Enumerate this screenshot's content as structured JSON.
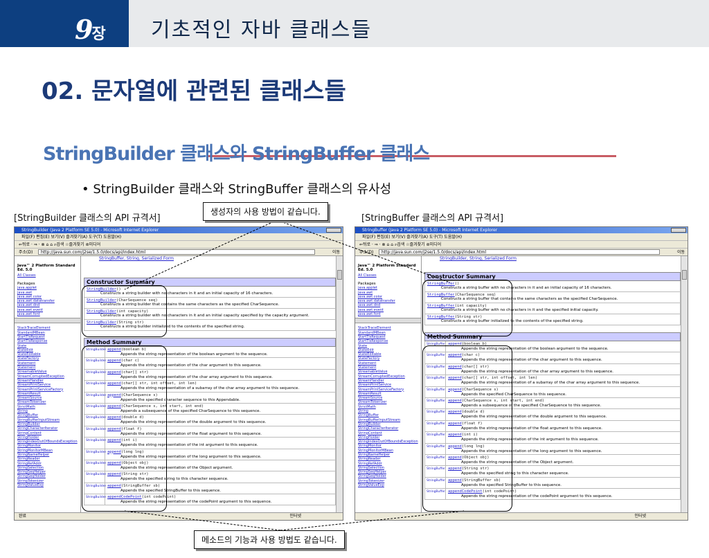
{
  "header": {
    "chapter_num": "9",
    "chapter_suffix": "장",
    "chapter_title": "기초적인 자바 클래스들"
  },
  "section": {
    "title": "02. 문자열에 관련된 클래스들",
    "subtitle": "StringBuilder 클래스와 StringBuffer 클래스",
    "bullet": "• StringBuilder 클래스와 StringBuffer 클래스의 유사성"
  },
  "captions": {
    "left": "[StringBuilder 클래스의 API 규격서]",
    "right": "[StringBuffer 클래스의 API 규격서]"
  },
  "callouts": {
    "top": "생성자의 사용 방법이 같습니다.",
    "bottom": "메소드의 기능과 사용 방법도 같습니다."
  },
  "browser_left": {
    "title": "StringBuilder (Java 2 Platform SE 5.0) - Microsoft Internet Explorer",
    "menu": "파일(F)  편집(E)  보기(V)  즐겨찾기(A)  도구(T)  도움말(H)",
    "toolbar": "⇐뒤로 · ⇒ · ⊗ ⌂ ⌂  ⌕검색  ☆즐겨찾기  ⊚미디어",
    "addr_label": "주소(D)",
    "url": "http://java.sun.com/j2se/1.5.0/docs/api/index.html",
    "go": "이동",
    "status": "완료",
    "zone": "인터넷",
    "top_link": "StringBuffer, String, Serialized Form"
  },
  "browser_right": {
    "title": "StringBuffer (Java 2 Platform SE 5.0) - Microsoft Internet Explorer",
    "menu": "파일(F)  편집(E)  보기(V)  즐겨찾기(A)  도구(T)  도움말(H)",
    "toolbar": "⇐뒤로 · ⇒ · ⊗ ⌂ ⌂  ⌕검색  ☆즐겨찾기  ⊚미디어",
    "addr_label": "주소(D)",
    "url": "http://java.sun.com/j2se/1.5.0/docs/api/index.html",
    "go": "이동",
    "status": "",
    "zone": "인터넷",
    "top_link": "StringBuilder, String, Serialized Form"
  },
  "nav": {
    "platform": "Java™ 2 Platform Standard Ed. 5.0",
    "all_classes": "All Classes",
    "packages_label": "Packages",
    "packages": [
      "java.applet",
      "java.awt",
      "java.awt.color",
      "java.awt.datatransfer",
      "java.awt.dnd",
      "java.awt.event",
      "java.awt.font"
    ],
    "classes": [
      "StackTraceElement",
      "StandardMBean",
      "StartTlsRequest",
      "StartTlsResponse",
      "State",
      "StateEdit",
      "StateEditable",
      "StateFactory",
      "Statement",
      "Statement",
      "StreamableValue",
      "StreamCorruptedException",
      "StreamHandler",
      "StreamPrintService",
      "StreamPrintServiceFactory",
      "StreamResult",
      "StreamSource",
      "StreamTokenizer",
      "StrictMath",
      "String",
      "StringBuffer",
      "StringBufferInputStream",
      "StringBuilder",
      "StringCharacterIterator",
      "StringContent",
      "StringHolder",
      "StringIndexOutOfBoundsException",
      "StringMonitor",
      "StringMonitorMBean",
      "StringNameHelper",
      "StringReader",
      "StringRefAddr",
      "StringSelection",
      "StringSeqHelper",
      "StringSeqHolder",
      "StringTokenizer",
      "StringValueExp"
    ]
  },
  "constructor_summary": {
    "header": "Constructor Summary",
    "rows": [
      {
        "name": "StringBuilder",
        "params": "()",
        "desc": "Constructs a string builder with no characters in it and an initial capacity of 16 characters."
      },
      {
        "name": "StringBuilder",
        "params": "(CharSequence seq)",
        "desc": "Constructs a string builder that contains the same characters as the specified CharSequence."
      },
      {
        "name": "StringBuilder",
        "params": "(int capacity)",
        "desc": "Constructs a string builder with no characters in it and an initial capacity specified by the capacity argument."
      },
      {
        "name": "StringBuilder",
        "params": "(String str)",
        "desc": "Constructs a string builder initialized to the contents of the specified string."
      }
    ]
  },
  "constructor_summary_right": {
    "header": "Constructor Summary",
    "rows": [
      {
        "name": "StringBuffer",
        "params": "()",
        "desc": "Constructs a string buffer with no characters in it and an initial capacity of 16 characters."
      },
      {
        "name": "StringBuffer",
        "params": "(CharSequence seq)",
        "desc": "Constructs a string buffer that contains the same characters as the specified CharSequence."
      },
      {
        "name": "StringBuffer",
        "params": "(int capacity)",
        "desc": "Constructs a string buffer with no characters in it and the specified initial capacity."
      },
      {
        "name": "StringBuffer",
        "params": "(String str)",
        "desc": "Constructs a string buffer initialized to the contents of the specified string."
      }
    ]
  },
  "method_summary": {
    "header": "Method Summary",
    "rows": [
      {
        "rt": "StringBuilder",
        "sig": "(boolean b)",
        "desc": "Appends the string representation of the boolean argument to the sequence."
      },
      {
        "rt": "StringBuilder",
        "sig": "(char c)",
        "desc": "Appends the string representation of the char argument to this sequence."
      },
      {
        "rt": "StringBuilder",
        "sig": "(char[] str)",
        "desc": "Appends the string representation of the char array argument to this sequence."
      },
      {
        "rt": "StringBuilder",
        "sig": "(char[] str, int offset, int len)",
        "desc": "Appends the string representation of a subarray of the char array argument to this sequence."
      },
      {
        "rt": "StringBuilder",
        "sig": "(CharSequence s)",
        "desc": "Appends the specified character sequence to this Appendable."
      },
      {
        "rt": "StringBuilder",
        "sig": "(CharSequence s, int start, int end)",
        "desc": "Appends a subsequence of the specified CharSequence to this sequence."
      },
      {
        "rt": "StringBuilder",
        "sig": "(double d)",
        "desc": "Appends the string representation of the double argument to this sequence."
      },
      {
        "rt": "StringBuilder",
        "sig": "(float f)",
        "desc": "Appends the string representation of the float argument to this sequence."
      },
      {
        "rt": "StringBuilder",
        "sig": "(int i)",
        "desc": "Appends the string representation of the int argument to this sequence."
      },
      {
        "rt": "StringBuilder",
        "sig": "(long lng)",
        "desc": "Appends the string representation of the long argument to this sequence."
      },
      {
        "rt": "StringBuilder",
        "sig": "(Object obj)",
        "desc": "Appends the string representation of the Object argument."
      },
      {
        "rt": "StringBuilder",
        "sig": "(String str)",
        "desc": "Appends the specified string to this character sequence."
      },
      {
        "rt": "StringBuilder",
        "sig": "(StringBuffer sb)",
        "desc": "Appends the specified StringBuffer to this sequence."
      },
      {
        "rt": "StringBuilder",
        "sig": "(int codePoint)",
        "desc": "Appends the string representation of the codePoint argument to this sequence.",
        "name": "appendCodePoint"
      }
    ]
  },
  "method_summary_right": {
    "header": "Method Summary",
    "rows": [
      {
        "rt": "StringBuffer",
        "sig": "(boolean b)",
        "desc": "Appends the string representation of the boolean argument to the sequence."
      },
      {
        "rt": "StringBuffer",
        "sig": "(char c)",
        "desc": "Appends the string representation of the char argument to this sequence."
      },
      {
        "rt": "StringBuffer",
        "sig": "(char[] str)",
        "desc": "Appends the string representation of the char array argument to this sequence."
      },
      {
        "rt": "StringBuffer",
        "sig": "(char[] str, int offset, int len)",
        "desc": "Appends the string representation of a subarray of the char array argument to this sequence."
      },
      {
        "rt": "StringBuffer",
        "sig": "(CharSequence s)",
        "desc": "Appends the specified CharSequence to this sequence."
      },
      {
        "rt": "StringBuffer",
        "sig": "(CharSequence s, int start, int end)",
        "desc": "Appends a subsequence of the specified CharSequence to this sequence."
      },
      {
        "rt": "StringBuffer",
        "sig": "(double d)",
        "desc": "Appends the string representation of the double argument to this sequence."
      },
      {
        "rt": "StringBuffer",
        "sig": "(float f)",
        "desc": "Appends the string representation of the float argument to this sequence."
      },
      {
        "rt": "StringBuffer",
        "sig": "(int i)",
        "desc": "Appends the string representation of the int argument to this sequence."
      },
      {
        "rt": "StringBuffer",
        "sig": "(long lng)",
        "desc": "Appends the string representation of the long argument to this sequence."
      },
      {
        "rt": "StringBuffer",
        "sig": "(Object obj)",
        "desc": "Appends the string representation of the Object argument."
      },
      {
        "rt": "StringBuffer",
        "sig": "(String str)",
        "desc": "Appends the specified string to this character sequence."
      },
      {
        "rt": "StringBuffer",
        "sig": "(StringBuffer sb)",
        "desc": "Appends the specified StringBuffer to this sequence."
      },
      {
        "rt": "StringBuffer",
        "sig": "(int codePoint)",
        "desc": "Appends the string representation of the codePoint argument to this sequence.",
        "name": "appendCodePoint"
      }
    ]
  },
  "method_default_name": "append",
  "colors": {
    "chapter_block": "#0d3f80",
    "title": "#1c3a78",
    "subtitle": "#4a74b4",
    "underline": "#c85c64",
    "summary_header": "#ccccff"
  }
}
